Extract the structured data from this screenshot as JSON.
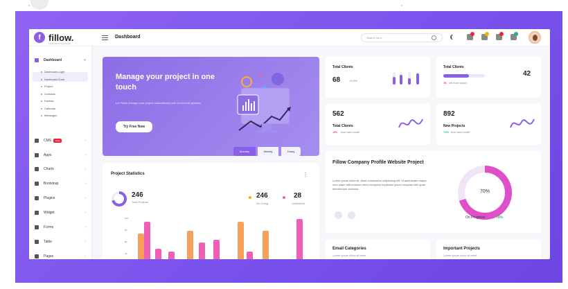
{
  "app": {
    "name": "fillow.",
    "tagline": "Fillow Admin Dashboard"
  },
  "header": {
    "title": "Dashboard",
    "search_placeholder": "Search here..."
  },
  "sidebar": {
    "active": "Dashboard",
    "items": [
      {
        "label": "Dashboard",
        "icon": "home-icon",
        "open": true
      },
      {
        "label": "CMS",
        "icon": "chart-line-icon",
        "badge": "New"
      },
      {
        "label": "Apps",
        "icon": "apps-icon"
      },
      {
        "label": "Charts",
        "icon": "charts-icon"
      },
      {
        "label": "Bootstrap",
        "icon": "bootstrap-icon"
      },
      {
        "label": "Plugins",
        "icon": "heart-icon"
      },
      {
        "label": "Widget",
        "icon": "user-icon"
      },
      {
        "label": "Forms",
        "icon": "file-icon"
      },
      {
        "label": "Table",
        "icon": "table-icon"
      },
      {
        "label": "Pages",
        "icon": "pages-icon"
      }
    ],
    "subitems": [
      "Dashboard Light",
      "Dashboard Dark",
      "Project",
      "Contacts",
      "Kanban",
      "Calendar",
      "Messages"
    ]
  },
  "hero": {
    "title": "Manage your project in one touch",
    "description": "Let Fillow manage your project automatically with our best AI systems",
    "button": "Try Free Now"
  },
  "cards": {
    "total_clients_1": {
      "title": "Total Clients",
      "value": "68",
      "change": "+0.5%"
    },
    "total_clients_2": {
      "title": "Total Clients",
      "value": "42",
      "note_value": "76",
      "note_text": "left from target",
      "progress": 0.62
    },
    "total_clients_3": {
      "value": "562",
      "title": "Total Clients",
      "change": "-2%",
      "change_text": "than last month"
    },
    "new_projects": {
      "value": "892",
      "title": "New Projects",
      "change": "+2%",
      "change_text": "than last month"
    },
    "company_profile": {
      "title": "Fillow Company Profile Website Project",
      "text": "Lorem ipsum dolor sit, amet consectetur adipisicing elit. Id quibusdam eaque vero ullam edit nostrum nemo excepturi explicabo ipsum voluptas nihil quae doloremque ducimus.",
      "percent": "70%",
      "progress_label": "On Progress",
      "progress_value": "70%",
      "progress": 0.7
    },
    "email_categories": {
      "title": "Email Categories",
      "text": "Lorem ipsum dolor sit amet"
    },
    "important_projects": {
      "title": "Important Projects",
      "text": "Lorem ipsum dolor sit amet"
    }
  },
  "project_statistics": {
    "title": "Project Statistics",
    "tabs": [
      "Monthly",
      "Weekly",
      "Today"
    ],
    "active_tab": "Monthly",
    "total_value": "246",
    "total_label": "Total Projects",
    "ongoing_value": "246",
    "ongoing_label": "On Going",
    "unfinished_value": "28",
    "unfinished_label": "Unfinished"
  },
  "chart_data": {
    "type": "bar",
    "title": "Project Statistics",
    "y_ticks": [
      "100",
      "80",
      "60",
      "40"
    ],
    "ylim": [
      0,
      100
    ],
    "series": [
      {
        "name": "On Going",
        "color": "#f5a15b",
        "values": [
          55,
          0,
          0,
          60,
          0,
          0,
          75,
          0,
          60,
          0
        ]
      },
      {
        "name": "Unfinished",
        "color": "#ee5fb7",
        "values": [
          75,
          30,
          25,
          0,
          40,
          45,
          0,
          25,
          0,
          80
        ]
      }
    ]
  },
  "colors": {
    "primary": "#8a5ee8",
    "orange": "#f5a15b",
    "pink": "#ee5fb7",
    "green": "#2bb673",
    "red": "#e8273a"
  }
}
